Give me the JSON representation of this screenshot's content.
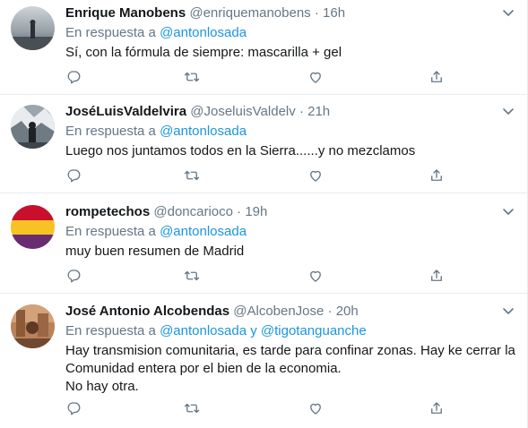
{
  "reply_prefix": "En respuesta a",
  "tweets": [
    {
      "name": "Enrique Manobens",
      "handle": "@enriquemanobens",
      "separator": "·",
      "time": "16h",
      "reply_to": [
        "@antonlosada"
      ],
      "text": [
        "Sí, con la fórmula de siempre: mascarilla + gel"
      ]
    },
    {
      "name": "JoséLuisValdelvira",
      "handle": "@JoseluisValdelv",
      "separator": "·",
      "time": "21h",
      "reply_to": [
        "@antonlosada"
      ],
      "text": [
        "Luego nos juntamos todos en la Sierra......y no mezclamos"
      ]
    },
    {
      "name": "rompetechos",
      "handle": "@doncarioco",
      "separator": "·",
      "time": "19h",
      "reply_to": [
        "@antonlosada"
      ],
      "text": [
        "muy buen resumen de Madrid"
      ]
    },
    {
      "name": "José Antonio Alcobendas",
      "handle": "@AlcobenJose",
      "separator": "·",
      "time": "20h",
      "reply_to": [
        "@antonlosada",
        "@tigotanguanche"
      ],
      "reply_joiner": "y",
      "text": [
        "Hay transmision comunitaria, es tarde para confinar zonas. Hay ke cerrar la",
        "Comunidad entera por el bien de la economia.",
        "No hay otra."
      ]
    }
  ],
  "icons": {
    "more": "chevron-down-icon",
    "reply": "reply-icon",
    "retweet": "retweet-icon",
    "like": "like-icon",
    "share": "share-icon"
  },
  "colors": {
    "name": "#14171a",
    "secondary": "#657786",
    "mention": "#1b95e0",
    "divider": "#e6ecf0",
    "icon": "#657786"
  }
}
